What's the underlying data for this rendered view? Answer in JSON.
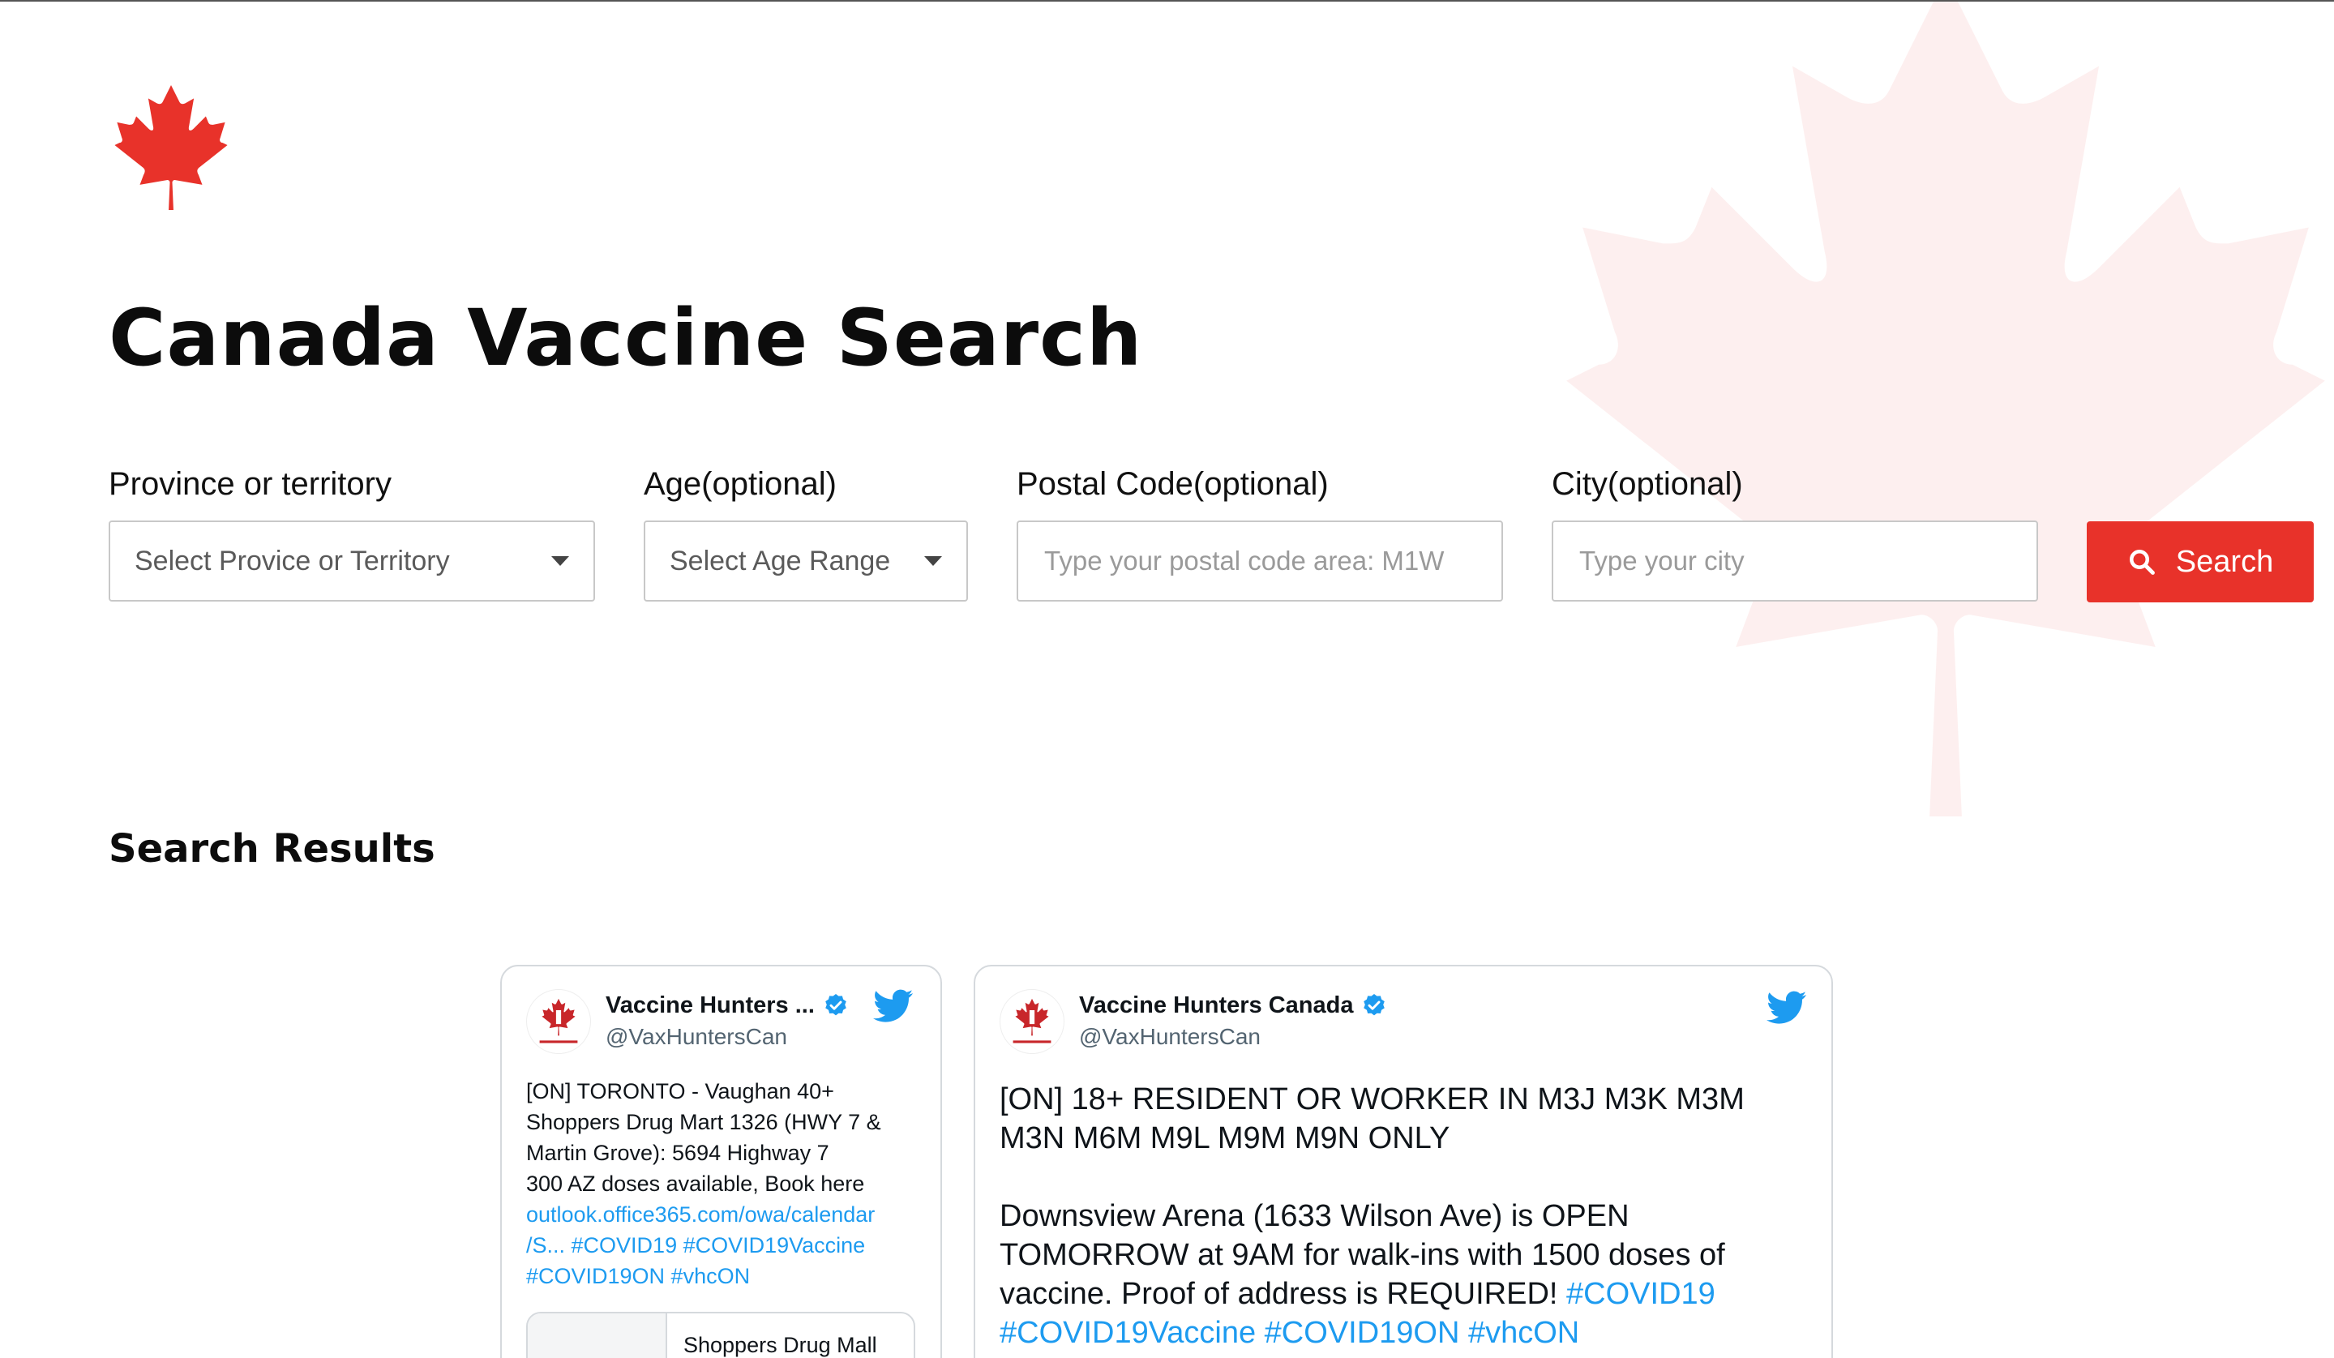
{
  "page": {
    "title": "Canada Vaccine Search",
    "brand_color": "#e8322a"
  },
  "filters": {
    "province": {
      "label": "Province or territory",
      "selected": "Select Provice or Territory"
    },
    "age": {
      "label": "Age(optional)",
      "selected": "Select Age Range"
    },
    "postal_code": {
      "label": "Postal Code(optional)",
      "placeholder": "Type your postal code area: M1W",
      "value": ""
    },
    "city": {
      "label": "City(optional)",
      "placeholder": "Type your city",
      "value": ""
    },
    "search_button": {
      "label": "Search",
      "icon": "search-icon"
    }
  },
  "results": {
    "heading": "Search Results",
    "tweets": [
      {
        "author": "Vaccine Hunters ...",
        "handle": "@VaxHuntersCan",
        "verified": true,
        "text": "[ON] TORONTO - Vaughan 40+\nShoppers Drug Mart 1326 (HWY 7 &\nMartin Grove): 5694 Highway 7\n300 AZ doses available, Book here",
        "link": "outlook.office365.com/owa/calendar\n/S...",
        "hashtags": "#COVID19 #COVID19Vaccine\n#COVID19ON #vhcON",
        "card_title": "Shoppers Drug Mall"
      },
      {
        "author": "Vaccine Hunters Canada",
        "handle": "@VaxHuntersCan",
        "verified": true,
        "text": "[ON] 18+ RESIDENT OR WORKER IN M3J M3K M3M\nM3N M6M M9L M9M M9N ONLY\n\nDownsview Arena (1633 Wilson Ave) is OPEN\nTOMORROW at 9AM for walk-ins with 1500 doses of\nvaccine. Proof of address is REQUIRED! ",
        "hashtags_inline": "#COVID19",
        "hashtags": "#COVID19Vaccine #COVID19ON #vhcON"
      }
    ]
  },
  "icons": {
    "logo": "maple-leaf-icon",
    "background": "maple-leaf-icon",
    "dropdown": "caret-down-icon",
    "twitter": "twitter-bird-icon",
    "verified": "verified-badge-icon"
  },
  "colors": {
    "twitter_blue": "#1d9bf0",
    "verified_blue": "#1d9bf0",
    "border": "#c8c8c8"
  }
}
